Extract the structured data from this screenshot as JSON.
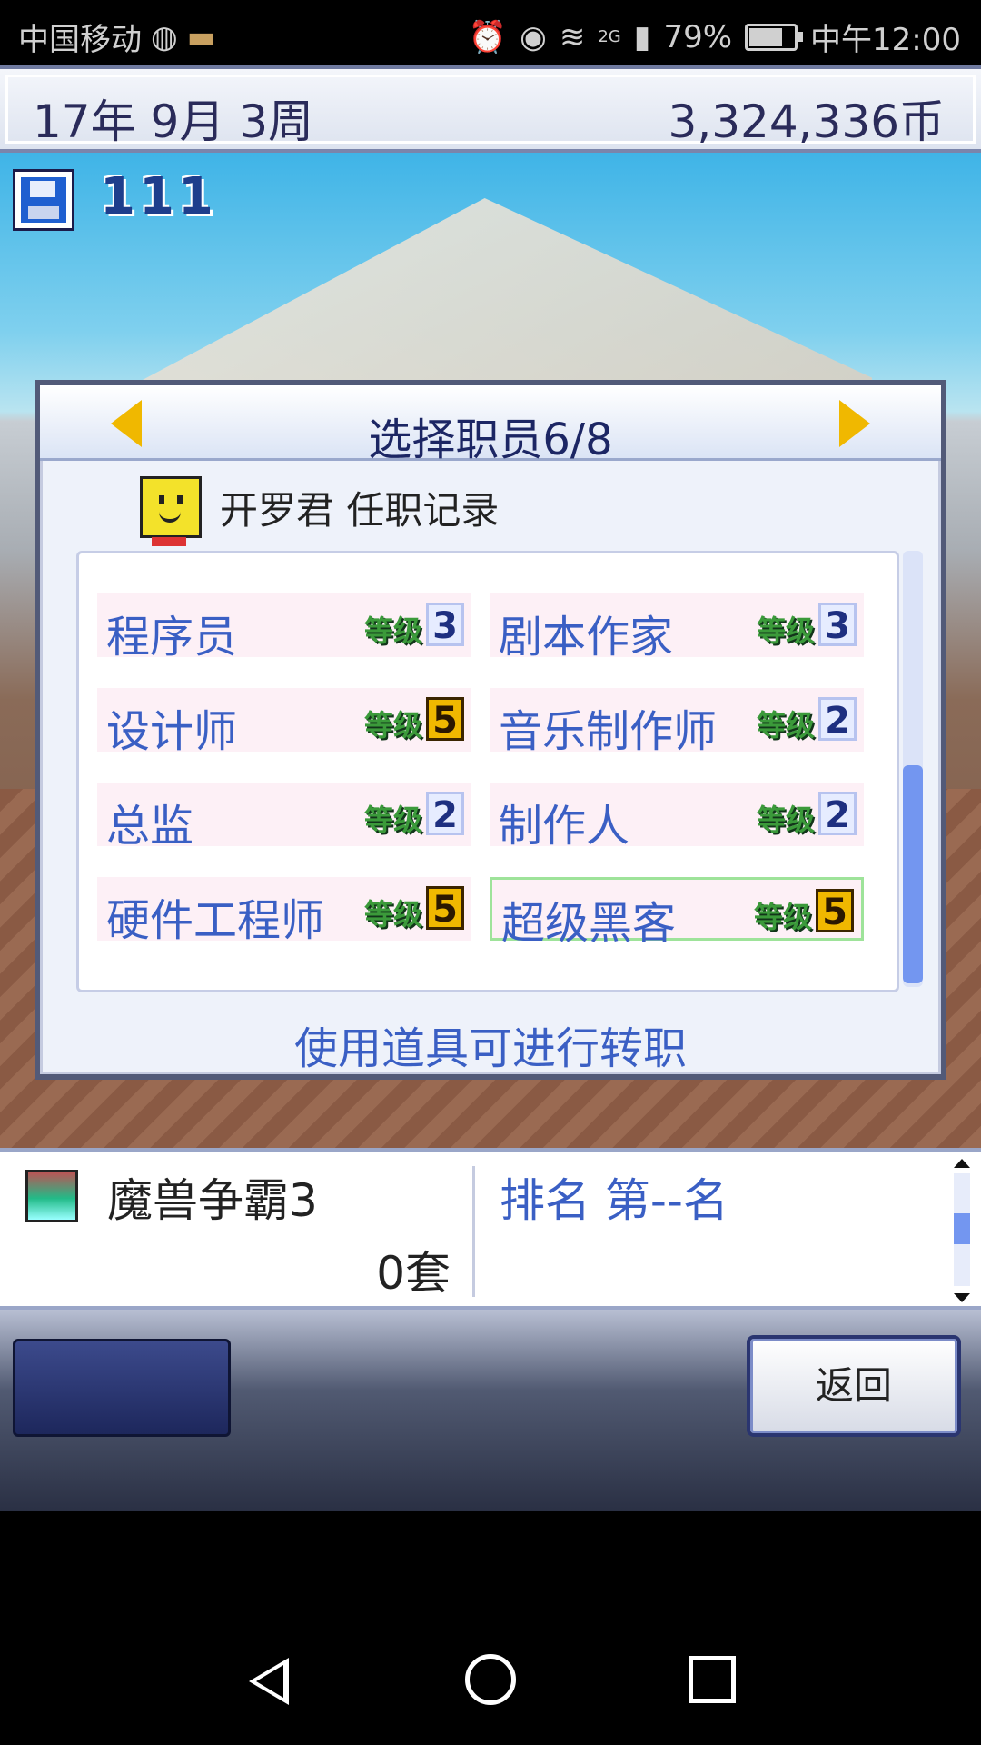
{
  "status_bar": {
    "carrier": "中国移动",
    "network": "2G",
    "battery": "79%",
    "time": "中午12:00"
  },
  "header": {
    "date": "17年 9月 3周",
    "money": "3,324,336币"
  },
  "scene": {
    "save_slots_label": "111"
  },
  "dialog": {
    "title": "选择职员6/8",
    "staff_name_title": "开罗君 任职记录",
    "jobs": [
      {
        "name": "程序员",
        "level_label": "等级",
        "level": "3"
      },
      {
        "name": "剧本作家",
        "level_label": "等级",
        "level": "3"
      },
      {
        "name": "设计师",
        "level_label": "等级",
        "level": "5"
      },
      {
        "name": "音乐制作师",
        "level_label": "等级",
        "level": "2"
      },
      {
        "name": "总监",
        "level_label": "等级",
        "level": "2"
      },
      {
        "name": "制作人",
        "level_label": "等级",
        "level": "2"
      },
      {
        "name": "硬件工程师",
        "level_label": "等级",
        "level": "5"
      },
      {
        "name": "超级黑客",
        "level_label": "等级",
        "level": "5"
      }
    ],
    "hint": "使用道具可进行转职"
  },
  "game_panel": {
    "game_name": "魔兽争霸3",
    "sales": "0套",
    "rank": "排名 第--名"
  },
  "controls": {
    "back_label": "返回"
  },
  "icons": {
    "save": "floppy-disk-icon",
    "prev": "left-arrow-icon",
    "next": "right-arrow-icon",
    "staff": "staff-face-icon",
    "game": "game-cover-icon"
  },
  "colors": {
    "accent_blue": "#3a5fc4",
    "gold": "#f0b800",
    "level_green": "#3b9a3a"
  }
}
